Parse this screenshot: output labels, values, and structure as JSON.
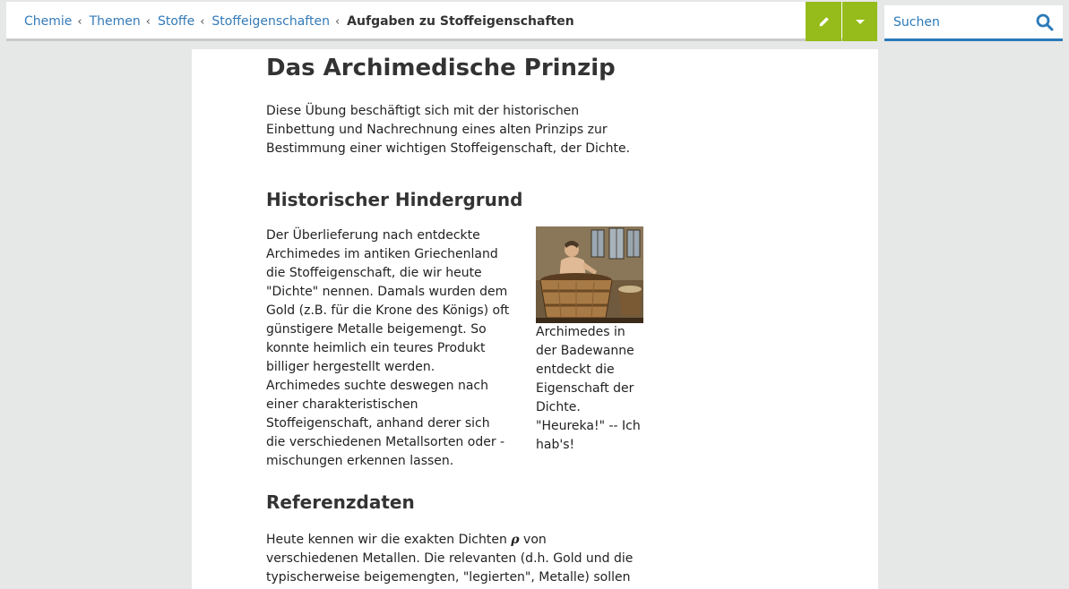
{
  "breadcrumb": {
    "items": [
      "Chemie",
      "Themen",
      "Stoffe",
      "Stoffeigenschaften"
    ],
    "current": "Aufgaben zu Stoffeigenschaften",
    "separator": "‹"
  },
  "search": {
    "placeholder": "Suchen"
  },
  "colors": {
    "accent_green": "#95bc1a",
    "link_blue": "#337ab7",
    "search_blue": "#2a7ab8"
  },
  "article": {
    "title": "Das Archimedische Prinzip",
    "intro": "Diese Übung beschäftigt sich mit der historischen Einbettung und Nachrechnung eines alten Prinzips zur Bestimmung einer wichtigen Stoffeigenschaft, der Dichte.",
    "history": {
      "heading": "Historischer Hindergrund",
      "text": "Der Überlieferung nach entdeckte Archi­medes im antiken Griechenland die Stoff­eigenschaft, die wir heute \"Dichte\" nen­nen. Damals wurden dem Gold (z.B. für die Krone des Königs) oft günstigere Me­talle beigemengt. So konnte heimlich ein teures Produkt billiger hergestellt wer­den. Archimedes suchte deswegen nach einer charakteristischen Stoffeigenschaft, anhand derer sich die verschiedenen Me­tallsorten oder -mischungen erkennen lassen.",
      "figure_caption": "Archimedes in der Badewanne ent­deckt die Eigen­schaft der Dichte. \"Heureka!\" -- Ich hab's!"
    },
    "reference": {
      "heading": "Referenzdaten",
      "text_before": "Heute kennen wir die exakten Dichten ",
      "symbol": "ρ",
      "text_after": " von verschiedenen Me­tallen. Die relevanten (d.h. Gold und die typischerweise beige­mengten, \"legierten\", Metalle) sollen hier genannt werden."
    }
  }
}
